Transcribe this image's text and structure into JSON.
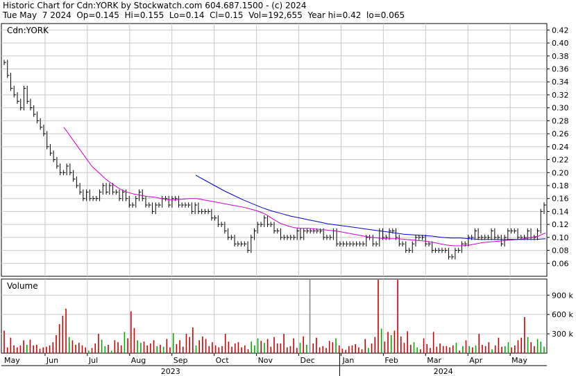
{
  "header": {
    "line1": "Historic Chart for Cdn:YORK by Stockwatch.com 604.687.1500 - (c) 2024",
    "line2": "Tue May  7 2024  Op=0.145  Hi=0.155  Lo=0.14  Cl=0.15  Vol=192,655  Year hi=0.42  lo=0.065"
  },
  "colors": {
    "price_bar": "#000000",
    "ma_short": "#cc00cc",
    "ma_long": "#0000cc",
    "vol_up": "#00aa00",
    "vol_down": "#cc0000",
    "vol_neutral": "#888888",
    "grid": "#c8c8c8"
  },
  "chart_data": {
    "type": "line",
    "price_panel": {
      "label": "Cdn:YORK",
      "ylim": [
        0.04,
        0.43
      ],
      "yticks": [
        "0.06",
        "0.08",
        "0.10",
        "0.12",
        "0.14",
        "0.16",
        "0.18",
        "0.20",
        "0.22",
        "0.24",
        "0.26",
        "0.28",
        "0.30",
        "0.32",
        "0.34",
        "0.36",
        "0.38",
        "0.40",
        "0.42"
      ],
      "ohlc_close": [
        0.37,
        0.35,
        0.33,
        0.32,
        0.31,
        0.3,
        0.33,
        0.31,
        0.3,
        0.29,
        0.28,
        0.27,
        0.26,
        0.24,
        0.23,
        0.22,
        0.21,
        0.2,
        0.2,
        0.21,
        0.2,
        0.19,
        0.18,
        0.17,
        0.16,
        0.17,
        0.16,
        0.16,
        0.16,
        0.17,
        0.18,
        0.17,
        0.18,
        0.17,
        0.17,
        0.16,
        0.17,
        0.16,
        0.15,
        0.15,
        0.16,
        0.17,
        0.16,
        0.15,
        0.15,
        0.14,
        0.15,
        0.15,
        0.16,
        0.16,
        0.15,
        0.16,
        0.16,
        0.15,
        0.15,
        0.15,
        0.15,
        0.14,
        0.15,
        0.14,
        0.14,
        0.14,
        0.14,
        0.13,
        0.13,
        0.12,
        0.12,
        0.11,
        0.1,
        0.1,
        0.09,
        0.09,
        0.09,
        0.09,
        0.08,
        0.1,
        0.11,
        0.12,
        0.12,
        0.13,
        0.12,
        0.12,
        0.11,
        0.11,
        0.1,
        0.1,
        0.1,
        0.1,
        0.1,
        0.11,
        0.1,
        0.11,
        0.11,
        0.11,
        0.11,
        0.11,
        0.11,
        0.1,
        0.1,
        0.1,
        0.11,
        0.09,
        0.09,
        0.09,
        0.09,
        0.09,
        0.09,
        0.09,
        0.09,
        0.09,
        0.1,
        0.1,
        0.09,
        0.09,
        0.11,
        0.1,
        0.1,
        0.11,
        0.11,
        0.1,
        0.09,
        0.09,
        0.08,
        0.08,
        0.09,
        0.1,
        0.1,
        0.1,
        0.09,
        0.09,
        0.08,
        0.08,
        0.08,
        0.08,
        0.08,
        0.07,
        0.07,
        0.08,
        0.08,
        0.09,
        0.09,
        0.1,
        0.1,
        0.11,
        0.1,
        0.1,
        0.1,
        0.1,
        0.11,
        0.1,
        0.1,
        0.09,
        0.1,
        0.11,
        0.11,
        0.11,
        0.1,
        0.1,
        0.1,
        0.11,
        0.1,
        0.1,
        0.11,
        0.14,
        0.15
      ],
      "x_labels_month": [
        "May",
        "Jun",
        "Jul",
        "Aug",
        "Sep",
        "Oct",
        "Nov",
        "Dec",
        "Jan",
        "Feb",
        "Mar",
        "Apr",
        "May"
      ],
      "x_labels_year": [
        "2023",
        "2024"
      ]
    },
    "series": [
      {
        "values": [
          0.27,
          0.255,
          0.24,
          0.225,
          0.21,
          0.2,
          0.19,
          0.182,
          0.175,
          0.17,
          0.167,
          0.165,
          0.163,
          0.162,
          0.16,
          0.158,
          0.158,
          0.159,
          0.16,
          0.16,
          0.158,
          0.156,
          0.154,
          0.152,
          0.15,
          0.148,
          0.146,
          0.143,
          0.14,
          0.135,
          0.128,
          0.122,
          0.118,
          0.115,
          0.114,
          0.114,
          0.113,
          0.112,
          0.111,
          0.11,
          0.108,
          0.106,
          0.104,
          0.102,
          0.1,
          0.099,
          0.098,
          0.098,
          0.098,
          0.097,
          0.096,
          0.095,
          0.094,
          0.092,
          0.09,
          0.088,
          0.087,
          0.087,
          0.088,
          0.09,
          0.092,
          0.093,
          0.094,
          0.095,
          0.096,
          0.097,
          0.098,
          0.1,
          0.102,
          0.107
        ]
      },
      {
        "values": [
          0.196,
          0.188,
          0.18,
          0.172,
          0.165,
          0.158,
          0.152,
          0.146,
          0.141,
          0.137,
          0.133,
          0.13,
          0.127,
          0.124,
          0.121,
          0.119,
          0.117,
          0.115,
          0.113,
          0.111,
          0.109,
          0.107,
          0.105,
          0.104,
          0.103,
          0.102,
          0.1,
          0.099,
          0.099,
          0.098,
          0.097,
          0.097,
          0.097,
          0.097,
          0.097,
          0.097,
          0.097,
          0.098
        ]
      }
    ],
    "volume_panel": {
      "label": "Volume",
      "ylim": [
        0,
        1150000
      ],
      "yticks": [
        "300 k",
        "600 k",
        "900 k"
      ],
      "values": [
        350,
        90,
        240,
        120,
        90,
        120,
        200,
        130,
        210,
        120,
        130,
        70,
        90,
        100,
        120,
        170,
        280,
        450,
        580,
        690,
        250,
        200,
        130,
        160,
        120,
        90,
        40,
        80,
        150,
        300,
        210,
        110,
        130,
        40,
        200,
        170,
        120,
        330,
        230,
        650,
        390,
        200,
        160,
        180,
        120,
        150,
        200,
        110,
        130,
        100,
        220,
        90,
        310,
        140,
        200,
        100,
        300,
        250,
        400,
        120,
        200,
        260,
        220,
        110,
        170,
        120,
        90,
        110,
        300,
        180,
        100,
        150,
        170,
        90,
        120,
        60,
        180,
        120,
        230,
        190,
        160,
        220,
        100,
        250,
        150,
        150,
        300,
        90,
        110,
        230,
        80,
        160,
        260,
        130,
        1350,
        150,
        240,
        90,
        110,
        80,
        190,
        170,
        230,
        120,
        70,
        50,
        110,
        120,
        140,
        90,
        60,
        220,
        80,
        150,
        250,
        1200,
        380,
        180,
        330,
        280,
        350,
        1180,
        260,
        160,
        340,
        130,
        170,
        90,
        60,
        230,
        140,
        80,
        330,
        100,
        150,
        110,
        110,
        90,
        120,
        160,
        40,
        110,
        200,
        110,
        90,
        120,
        300,
        130,
        110,
        170,
        60,
        120,
        240,
        100,
        110,
        170,
        90,
        120,
        200,
        240,
        560,
        250,
        170,
        110,
        220,
        180,
        100
      ]
    }
  }
}
